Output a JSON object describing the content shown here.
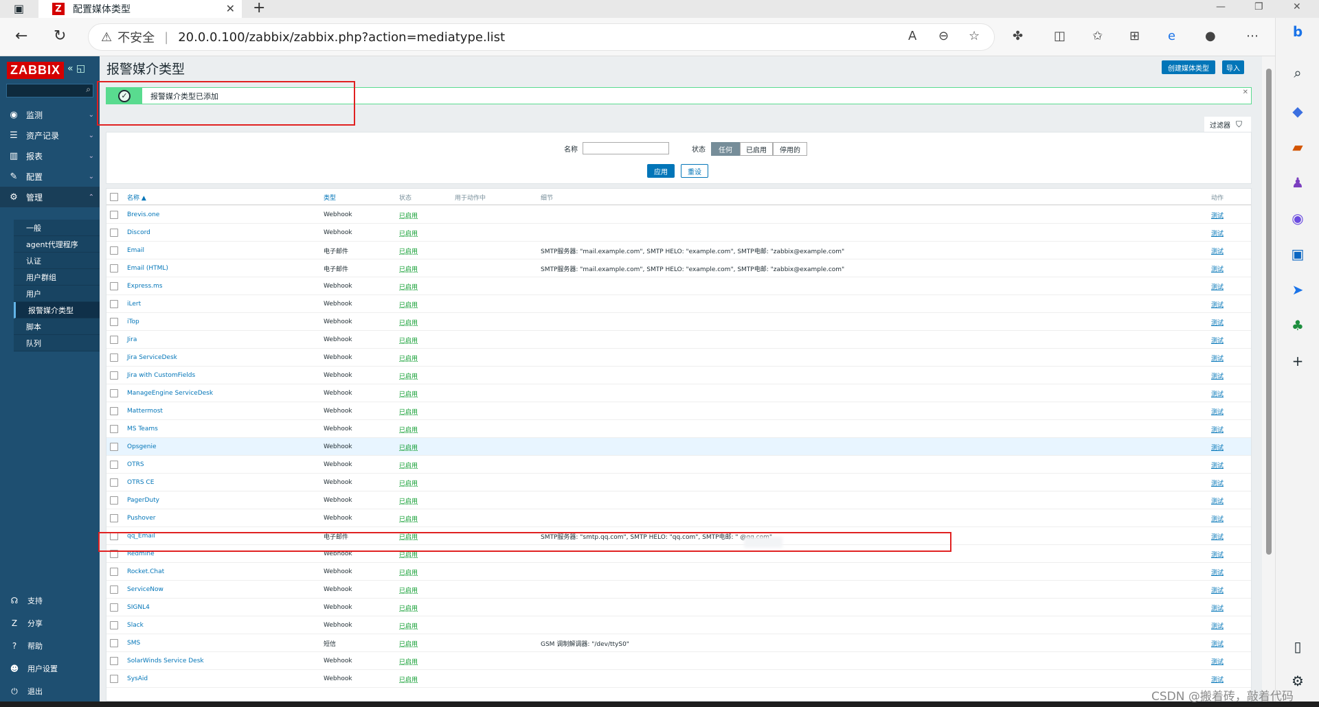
{
  "browser": {
    "tab_title": "配置媒体类型",
    "tab_favicon": "Z",
    "insecure_label": "不安全",
    "url": "20.0.0.100/zabbix/zabbix.php?action=mediatype.list"
  },
  "sidebar": {
    "logo": "ZABBIX",
    "menu": [
      {
        "label": "监测",
        "icon": "eye-icon"
      },
      {
        "label": "资产记录",
        "icon": "list-icon"
      },
      {
        "label": "报表",
        "icon": "chart-icon"
      },
      {
        "label": "配置",
        "icon": "wrench-icon"
      },
      {
        "label": "管理",
        "icon": "gear-icon"
      }
    ],
    "submenu": [
      "一般",
      "agent代理程序",
      "认证",
      "用户群组",
      "用户",
      "报警媒介类型",
      "脚本",
      "队列"
    ],
    "bottom": [
      {
        "label": "支持",
        "icon": "headset-icon"
      },
      {
        "label": "分享",
        "icon": "share-icon"
      },
      {
        "label": "帮助",
        "icon": "help-icon"
      },
      {
        "label": "用户设置",
        "icon": "user-icon"
      },
      {
        "label": "退出",
        "icon": "power-icon"
      }
    ]
  },
  "header": {
    "title": "报警媒介类型",
    "create_button": "创建媒体类型",
    "import_button": "导入"
  },
  "message": {
    "text": "报警媒介类型已添加"
  },
  "filter": {
    "tab_label": "过滤器",
    "name_label": "名称",
    "name_value": "",
    "status_label": "状态",
    "status_options": [
      "任何",
      "已启用",
      "停用的"
    ],
    "status_selected": "任何",
    "apply": "应用",
    "reset": "重设"
  },
  "table": {
    "headers": {
      "name": "名称 ▲",
      "type": "类型",
      "status": "状态",
      "used_in": "用于动作中",
      "details": "细节",
      "action": "动作"
    },
    "rows": [
      {
        "name": "Brevis.one",
        "type": "Webhook",
        "status": "已启用",
        "details": "",
        "action": "测试"
      },
      {
        "name": "Discord",
        "type": "Webhook",
        "status": "已启用",
        "details": "",
        "action": "测试"
      },
      {
        "name": "Email",
        "type": "电子邮件",
        "status": "已启用",
        "details": "SMTP服务器: \"mail.example.com\", SMTP HELO: \"example.com\", SMTP电邮: \"zabbix@example.com\"",
        "action": "测试"
      },
      {
        "name": "Email (HTML)",
        "type": "电子邮件",
        "status": "已启用",
        "details": "SMTP服务器: \"mail.example.com\", SMTP HELO: \"example.com\", SMTP电邮: \"zabbix@example.com\"",
        "action": "测试"
      },
      {
        "name": "Express.ms",
        "type": "Webhook",
        "status": "已启用",
        "details": "",
        "action": "测试"
      },
      {
        "name": "iLert",
        "type": "Webhook",
        "status": "已启用",
        "details": "",
        "action": "测试"
      },
      {
        "name": "iTop",
        "type": "Webhook",
        "status": "已启用",
        "details": "",
        "action": "测试"
      },
      {
        "name": "Jira",
        "type": "Webhook",
        "status": "已启用",
        "details": "",
        "action": "测试"
      },
      {
        "name": "Jira ServiceDesk",
        "type": "Webhook",
        "status": "已启用",
        "details": "",
        "action": "测试"
      },
      {
        "name": "Jira with CustomFields",
        "type": "Webhook",
        "status": "已启用",
        "details": "",
        "action": "测试"
      },
      {
        "name": "ManageEngine ServiceDesk",
        "type": "Webhook",
        "status": "已启用",
        "details": "",
        "action": "测试"
      },
      {
        "name": "Mattermost",
        "type": "Webhook",
        "status": "已启用",
        "details": "",
        "action": "测试"
      },
      {
        "name": "MS Teams",
        "type": "Webhook",
        "status": "已启用",
        "details": "",
        "action": "测试"
      },
      {
        "name": "Opsgenie",
        "type": "Webhook",
        "status": "已启用",
        "details": "",
        "action": "测试"
      },
      {
        "name": "OTRS",
        "type": "Webhook",
        "status": "已启用",
        "details": "",
        "action": "测试"
      },
      {
        "name": "OTRS CE",
        "type": "Webhook",
        "status": "已启用",
        "details": "",
        "action": "测试"
      },
      {
        "name": "PagerDuty",
        "type": "Webhook",
        "status": "已启用",
        "details": "",
        "action": "测试"
      },
      {
        "name": "Pushover",
        "type": "Webhook",
        "status": "已启用",
        "details": "",
        "action": "测试"
      },
      {
        "name": "qq_Email",
        "type": "电子邮件",
        "status": "已启用",
        "details": "SMTP服务器: \"smtp.qq.com\", SMTP HELO: \"qq.com\", SMTP电邮: \"              @qq.com\"",
        "action": "测试"
      },
      {
        "name": "Redmine",
        "type": "Webhook",
        "status": "已启用",
        "details": "",
        "action": "测试"
      },
      {
        "name": "Rocket.Chat",
        "type": "Webhook",
        "status": "已启用",
        "details": "",
        "action": "测试"
      },
      {
        "name": "ServiceNow",
        "type": "Webhook",
        "status": "已启用",
        "details": "",
        "action": "测试"
      },
      {
        "name": "SIGNL4",
        "type": "Webhook",
        "status": "已启用",
        "details": "",
        "action": "测试"
      },
      {
        "name": "Slack",
        "type": "Webhook",
        "status": "已启用",
        "details": "",
        "action": "测试"
      },
      {
        "name": "SMS",
        "type": "短信",
        "status": "已启用",
        "details": "GSM 调制解调器: \"/dev/ttyS0\"",
        "action": "测试"
      },
      {
        "name": "SolarWinds Service Desk",
        "type": "Webhook",
        "status": "已启用",
        "details": "",
        "action": "测试"
      },
      {
        "name": "SysAid",
        "type": "Webhook",
        "status": "已启用",
        "details": "",
        "action": "测试"
      }
    ]
  },
  "watermark": "CSDN @搬着砖，敲着代码",
  "colors": {
    "sidebar": "#1e4f71",
    "logo": "#d40000",
    "link": "#0275b8",
    "enabled": "#0c9c2e",
    "highlight": "#e02020"
  }
}
